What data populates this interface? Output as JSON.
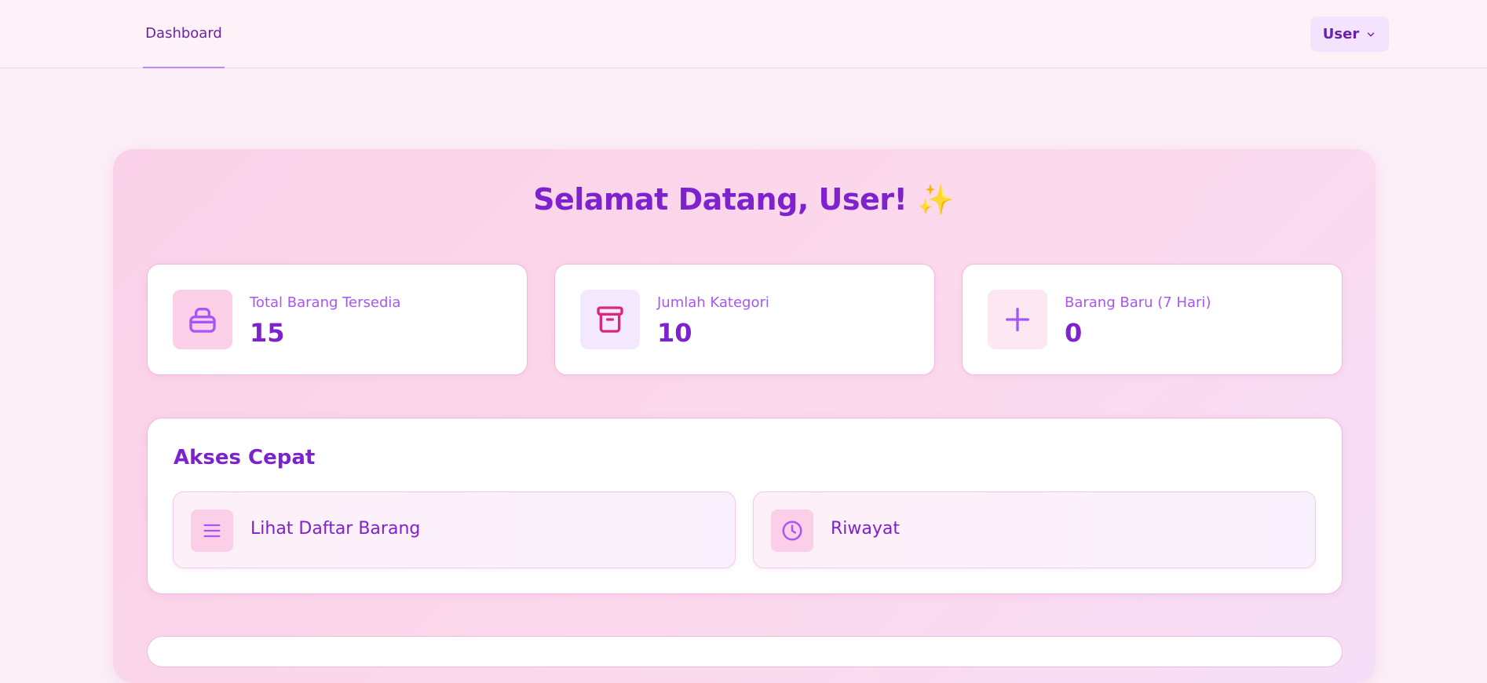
{
  "nav": {
    "dashboard_label": "Dashboard",
    "user_label": "User"
  },
  "welcome": {
    "text": "Selamat Datang, User!",
    "emoji": "✨"
  },
  "stats": [
    {
      "label": "Total Barang Tersedia",
      "value": "15",
      "icon": "basket-icon"
    },
    {
      "label": "Jumlah Kategori",
      "value": "10",
      "icon": "archive-icon"
    },
    {
      "label": "Barang Baru (7 Hari)",
      "value": "0",
      "icon": "plus-icon"
    }
  ],
  "quick_access": {
    "title": "Akses Cepat",
    "items": [
      {
        "label": "Lihat Daftar Barang",
        "icon": "list-icon"
      },
      {
        "label": "Riwayat",
        "icon": "clock-icon"
      }
    ]
  },
  "colors": {
    "accent": "#7e22ce",
    "light_accent": "#a855f7",
    "pink": "#db2777",
    "background": "#fcf0f8"
  }
}
